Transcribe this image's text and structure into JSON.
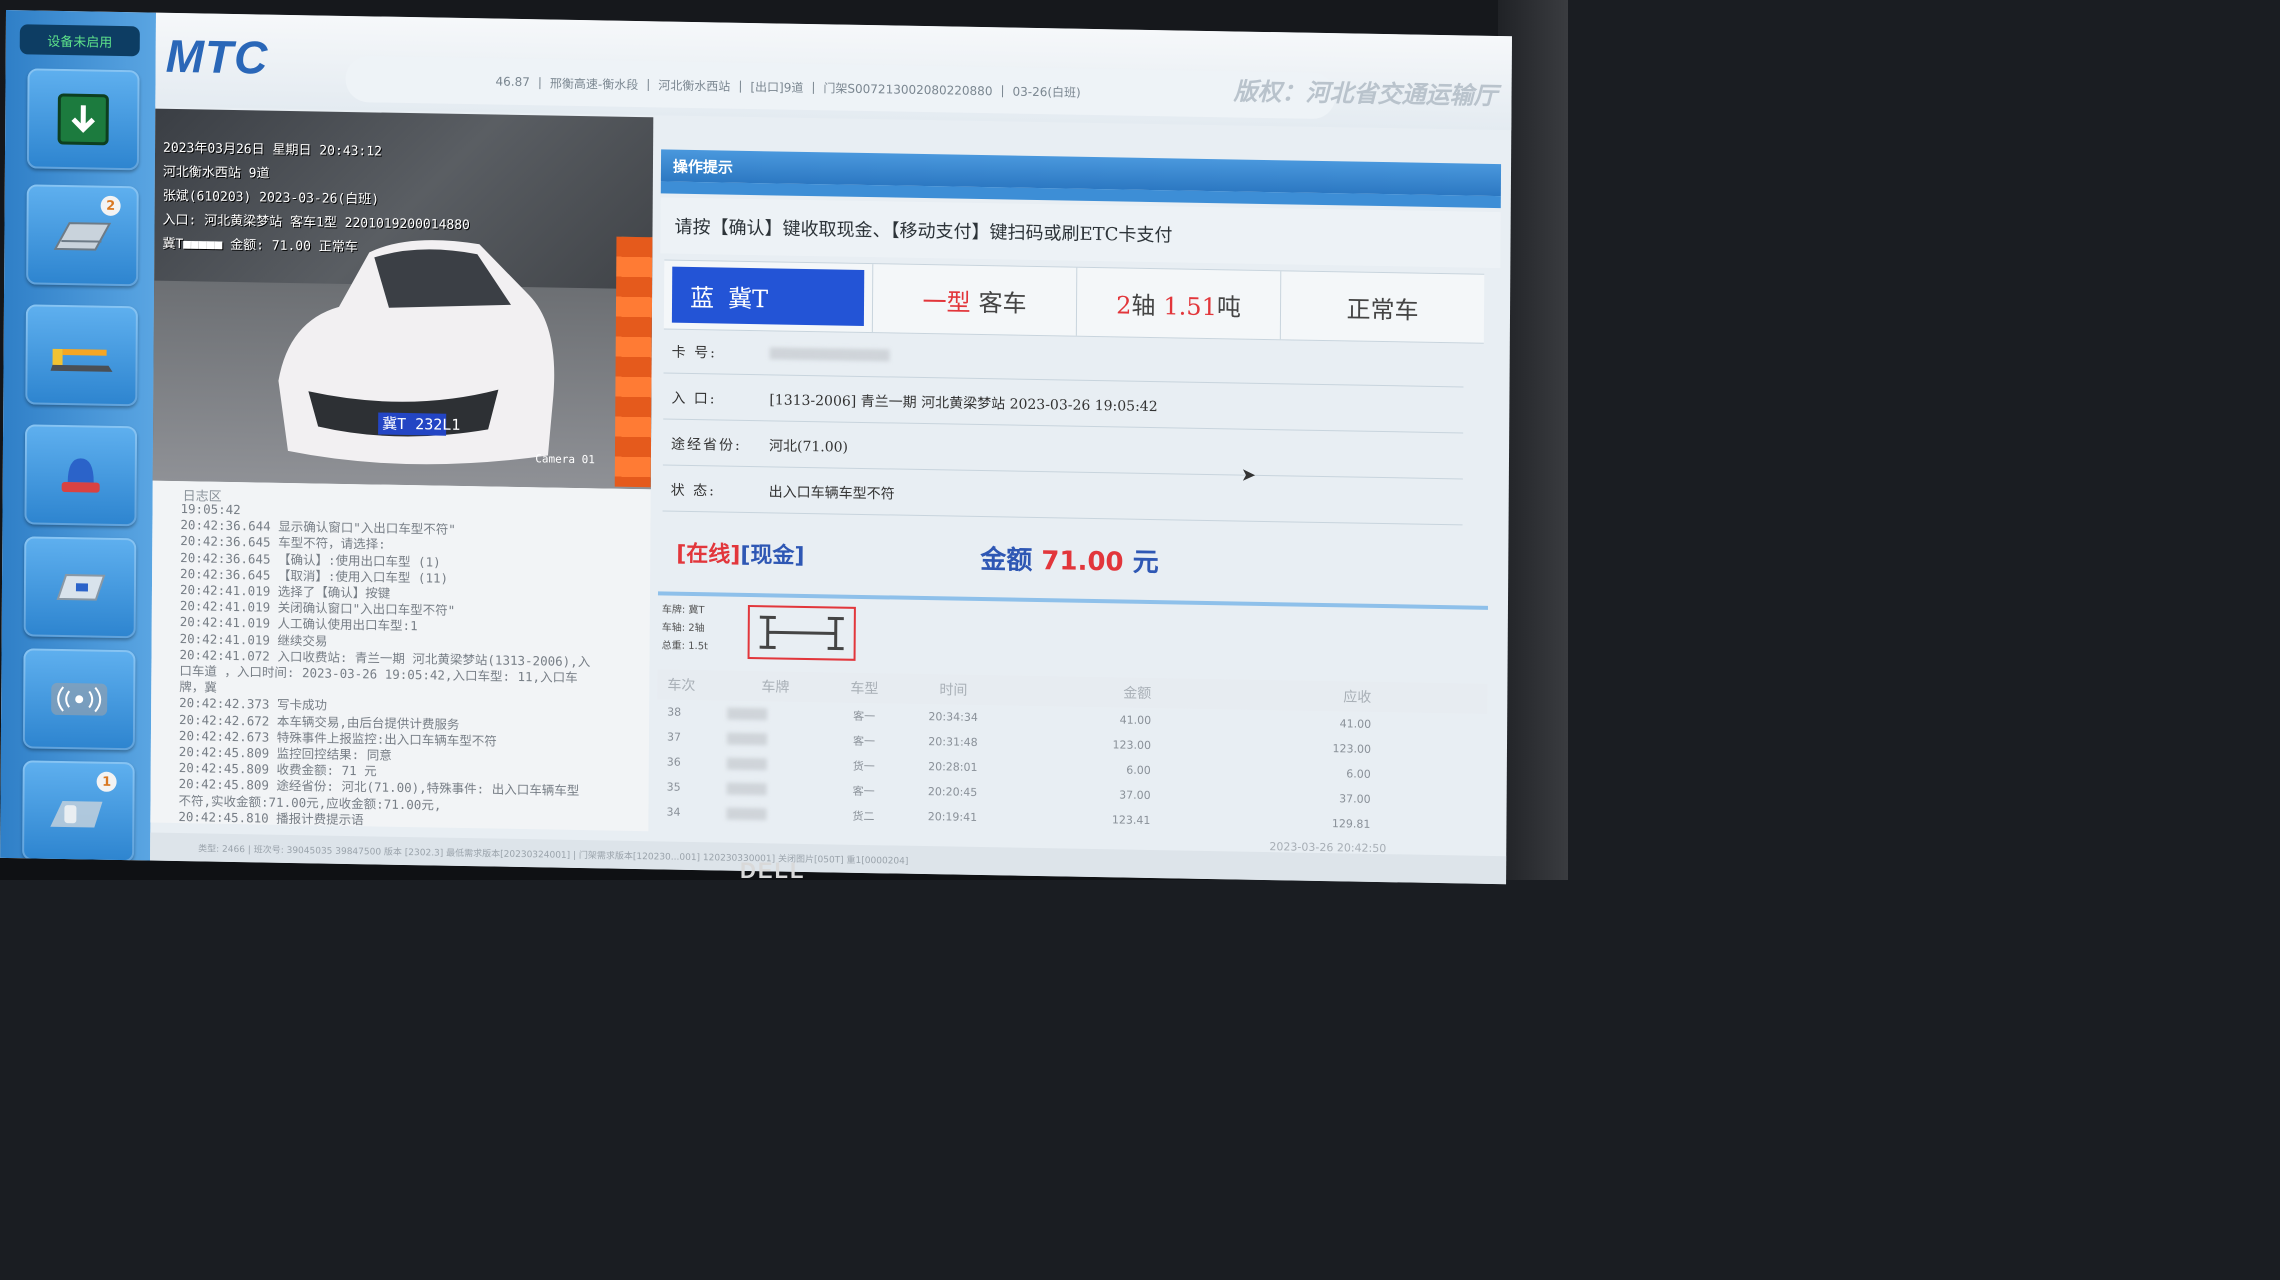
{
  "sidebar": {
    "device_status": "设备未启用",
    "badges": {
      "lane": "2",
      "queue": "1"
    }
  },
  "header": {
    "brand": "MTC",
    "info_segments": [
      "46.87",
      "邢衡高速-衡水段",
      "河北衡水西站",
      "[出口]9道",
      "门架S007213002080220880",
      "03-26(白班)"
    ],
    "copyright": "版权：河北省交通运输厅"
  },
  "camera": {
    "overlay_lines": [
      "2023年03月26日 星期日 20:43:12",
      "河北衡水西站 9道",
      "张斌(610203) 2023-03-26(白班)",
      "入口: 河北黄梁梦站 客车1型 2201019200014880",
      "冀T■■■■■ 金额: 71.00 正常车"
    ],
    "plate_text": "冀T 232L1",
    "label": "Camera 01"
  },
  "log": {
    "title": "日志区",
    "lines": [
      "19:05:42",
      "20:42:36.644 显示确认窗口\"入出口车型不符\"",
      "20:42:36.645 车型不符，请选择:",
      "20:42:36.645 【确认】:使用出口车型 (1)",
      "20:42:36.645 【取消】:使用入口车型 (11)",
      "20:42:41.019 选择了【确认】按键",
      "20:42:41.019 关闭确认窗口\"入出口车型不符\"",
      "20:42:41.019 人工确认使用出口车型:1",
      "20:42:41.019 继续交易",
      "20:42:41.072 入口收费站: 青兰一期 河北黄梁梦站(1313-2006),入",
      "口车道 ，入口时间: 2023-03-26 19:05:42,入口车型: 11,入口车",
      "牌，冀",
      "20:42:42.373 写卡成功",
      "20:42:42.672 本车辆交易,由后台提供计费服务",
      "20:42:42.673 特殊事件上报监控:出入口车辆车型不符",
      "20:42:45.809 监控回控结果: 同意",
      "20:42:45.809 收费金额: 71 元",
      "20:42:45.809 途经省份: 河北(71.00),特殊事件: 出入口车辆车型",
      "不符,实收金额:71.00元,应收金额:71.00元,",
      "20:42:45.810 播报计费提示语"
    ]
  },
  "ops": {
    "title": "操作提示",
    "prompt": "请按【确认】键收取现金、【移动支付】键扫码或刷ETC卡支付"
  },
  "vehicle": {
    "plate_color": "蓝",
    "plate_prefix": "冀T",
    "class_num": "一型",
    "class_name": "客车",
    "axles": "2",
    "axle_unit": "轴",
    "weight": "1.51",
    "weight_unit": "吨",
    "status": "正常车"
  },
  "details": {
    "card_label": "卡  号:",
    "entry_label": "入  口:",
    "entry_value": "[1313-2006] 青兰一期 河北黄梁梦站 2023-03-26 19:05:42",
    "province_label": "途经省份:",
    "province_value": "河北(71.00)",
    "state_label": "状  态:",
    "state_value": "出入口车辆车型不符"
  },
  "payment": {
    "online": "[在线]",
    "mode": "[现金]",
    "amount_label": "金额",
    "amount": "71.00",
    "unit": "元"
  },
  "axle_info": {
    "plate": "车牌: 冀T",
    "axles": "车轴: 2轴",
    "weight": "总重: 1.5t"
  },
  "history": {
    "headers": [
      "车次",
      "车牌",
      "车型",
      "时间",
      "金额",
      "应收"
    ],
    "rows": [
      {
        "no": "38",
        "type": "客一",
        "time": "20:34:34",
        "amount": "41.00",
        "due": "41.00"
      },
      {
        "no": "37",
        "type": "客一",
        "time": "20:31:48",
        "amount": "123.00",
        "due": "123.00"
      },
      {
        "no": "36",
        "type": "货一",
        "time": "20:28:01",
        "amount": "6.00",
        "due": "6.00"
      },
      {
        "no": "35",
        "type": "客一",
        "time": "20:20:45",
        "amount": "37.00",
        "due": "37.00"
      },
      {
        "no": "34",
        "type": "货二",
        "time": "20:19:41",
        "amount": "123.41",
        "due": "129.81"
      }
    ]
  },
  "timestamp": "2023-03-26 20:42:50",
  "footer": "类型: 2466 | 班次号: 39045035  39847500 版本 [2302.3]  最低需求版本[20230324001] | 门架需求版本[120230...001]  120230330001]  关闭图片[050T]  重1[0000204]",
  "colors": {
    "plate_blue": "#2354d6",
    "accent_red": "#e2363b",
    "header_blue": "#2c78c2"
  }
}
